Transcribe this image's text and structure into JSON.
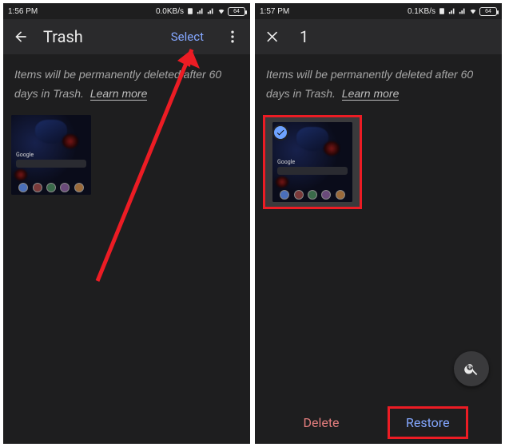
{
  "left": {
    "status": {
      "time": "1:56 PM",
      "net": "0.0KB/s",
      "battery": "64"
    },
    "appbar": {
      "title": "Trash",
      "select": "Select"
    },
    "banner": {
      "text": "Items will be permanently deleted after 60 days in Trash.",
      "learn": "Learn more"
    },
    "thumb": {
      "google": "Google"
    }
  },
  "right": {
    "status": {
      "time": "1:57 PM",
      "net": "0.1KB/s",
      "battery": "64"
    },
    "appbar": {
      "count": "1"
    },
    "banner": {
      "text": "Items will be permanently deleted after 60 days in Trash.",
      "learn": "Learn more"
    },
    "thumb": {
      "google": "Google"
    },
    "actions": {
      "delete": "Delete",
      "restore": "Restore"
    }
  }
}
